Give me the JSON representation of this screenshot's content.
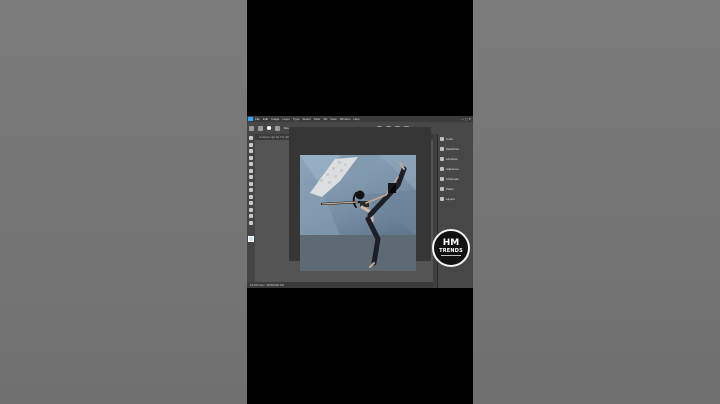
{
  "app": {
    "menu": [
      "File",
      "Edit",
      "Image",
      "Layer",
      "Type",
      "Select",
      "Filter",
      "3D",
      "View",
      "Window",
      "Help"
    ],
    "window_controls": "— ▢ ✕",
    "options": [
      "Mode:",
      "Brush",
      "Opacity:",
      "100%",
      "Flow:",
      "100%",
      "Smoothing:"
    ],
    "tabs": [
      "Untitled-1@ 66.7% (RGB/8)",
      "ready-tos-ca9f8f48f9c3e-unsplash.jpg @ 12.5% (Layer 0, RGB/8) *"
    ],
    "status": "12.5%    Doc: 28.6M/38.1M",
    "panels": [
      "Color",
      "Swatches",
      "Libraries",
      "Adjustme...",
      "Channels",
      "Paths",
      "Layers"
    ]
  },
  "watermark": {
    "line1": "HM",
    "line2": "TRENDS"
  },
  "colors": {
    "accent": "#31a8ff",
    "ui_dark": "#3b3b3b",
    "canvas": "#535353"
  }
}
